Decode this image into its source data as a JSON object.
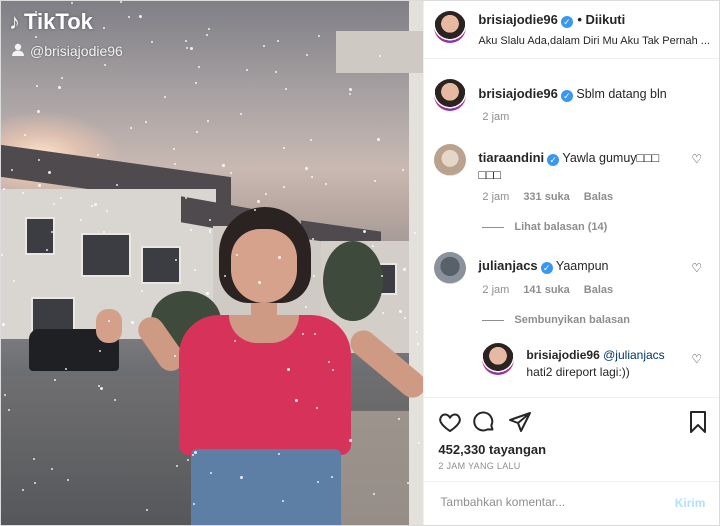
{
  "media": {
    "brand": "TikTok",
    "username": "@brisiajodie96"
  },
  "header": {
    "username": "brisiajodie96",
    "follow_status": "• Diikuti",
    "bio": "Aku Slalu Ada,dalam Diri Mu Aku Tak Pernah ..."
  },
  "caption": {
    "username": "brisiajodie96",
    "text": "Sblm datang bln",
    "time": "2 jam"
  },
  "comments": [
    {
      "username": "tiaraandini",
      "text": "Yawla gumuy□□□",
      "text2": "□□□",
      "time": "2 jam",
      "likes": "331 suka",
      "reply": "Balas",
      "replies_toggle": "Lihat balasan (14)"
    },
    {
      "username": "julianjacs",
      "text": "Yaampun",
      "time": "2 jam",
      "likes": "141 suka",
      "reply": "Balas",
      "replies_toggle": "Sembunyikan balasan"
    }
  ],
  "reply": {
    "username": "brisiajodie96",
    "mention": "@julianjacs",
    "text": "hati2 direport lagi:))"
  },
  "stats": {
    "views": "452,330 tayangan",
    "posted": "2 JAM YANG LALU"
  },
  "composer": {
    "placeholder": "Tambahkan komentar...",
    "post_label": "Kirim"
  }
}
